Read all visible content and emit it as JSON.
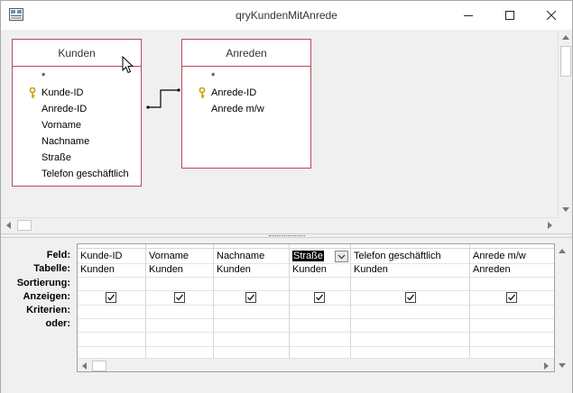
{
  "window": {
    "title": "qryKundenMitAnrede"
  },
  "tables": [
    {
      "name": "Kunden",
      "fields": [
        "*",
        "Kunde-ID",
        "Anrede-ID",
        "Vorname",
        "Nachname",
        "Straße",
        "Telefon geschäftlich"
      ],
      "key_field": "Kunde-ID"
    },
    {
      "name": "Anreden",
      "fields": [
        "*",
        "Anrede-ID",
        "Anrede m/w"
      ],
      "key_field": "Anrede-ID"
    }
  ],
  "grid": {
    "row_labels": [
      "Feld:",
      "Tabelle:",
      "Sortierung:",
      "Anzeigen:",
      "Kriterien:",
      "oder:"
    ],
    "columns": [
      {
        "field": "Kunde-ID",
        "table": "Kunden",
        "show": true
      },
      {
        "field": "Vorname",
        "table": "Kunden",
        "show": true
      },
      {
        "field": "Nachname",
        "table": "Kunden",
        "show": true
      },
      {
        "field": "Straße",
        "table": "Kunden",
        "show": true,
        "selected": true
      },
      {
        "field": "Telefon geschäftlich",
        "table": "Kunden",
        "show": true
      },
      {
        "field": "Anrede m/w",
        "table": "Anreden",
        "show": true
      }
    ]
  },
  "icons": {
    "app": "query-design-icon",
    "minimize": "minimize-icon",
    "maximize": "maximize-icon",
    "close": "close-icon",
    "key": "primary-key-icon",
    "dropdown": "chevron-down-icon"
  },
  "colors": {
    "table_border": "#b84a5a",
    "design_background": "#f0f0f0",
    "key": "#c8a000"
  }
}
